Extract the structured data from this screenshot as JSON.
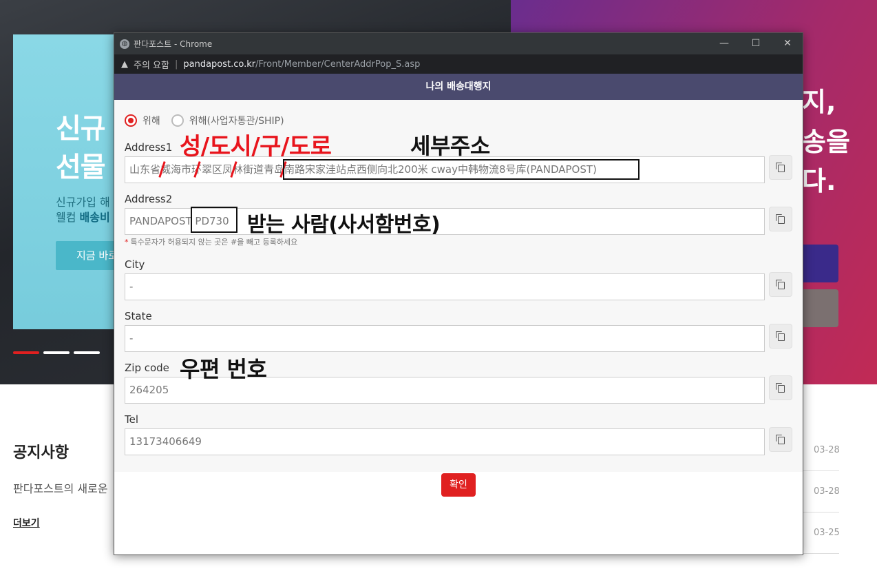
{
  "background": {
    "banner": {
      "title_line1": "신규",
      "title_line2": "선물",
      "sub_line1": "신규가입 해",
      "sub_line2_prefix": "웰컴",
      "sub_line2_bold": "배송비",
      "button": "지금 바로"
    },
    "hero_right_lines": [
      "지,",
      "송을",
      "다."
    ],
    "notice": {
      "title": "공지사항",
      "description": "판다포스트의 새로운",
      "more": "더보기",
      "dates": [
        "03-28",
        "03-28",
        "03-25"
      ]
    }
  },
  "window": {
    "title": "판다포스트 - Chrome",
    "controls": {
      "minimize": "—",
      "maximize": "☐",
      "close": "✕"
    },
    "url_warning": "주의 요함",
    "url_host": "pandapost.co.kr",
    "url_path": "/Front/Member/CenterAddrPop_S.asp"
  },
  "popup": {
    "header": "나의 배송대행지",
    "radios": [
      {
        "label": "위해",
        "checked": true
      },
      {
        "label": "위해(사업자통관/SHIP)",
        "checked": false
      }
    ],
    "fields": [
      {
        "label": "Address1",
        "value": "山东省威海市环翠区凤林街道青岛南路宋家洼站点西侧向北200米 cway中韩物流8号库(PANDAPOST)"
      },
      {
        "label": "Address2",
        "value": "PANDAPOST PD730"
      },
      {
        "label": "City",
        "value": "-"
      },
      {
        "label": "State",
        "value": "-"
      },
      {
        "label": "Zip code",
        "value": "264205"
      },
      {
        "label": "Tel",
        "value": "13173406649"
      }
    ],
    "note": "특수문자가 허용되지 않는 곳은 #을 빼고 등록하세요",
    "note_star": "*",
    "confirm": "확인"
  },
  "annotations": {
    "address1_red": "성/도시/구/도로",
    "address1_black": "세부주소",
    "address2": "받는 사람(사서함번호)",
    "zip": "우편 번호",
    "colors": {
      "red": "#e8141c",
      "black": "#111111"
    }
  },
  "colors": {
    "header_bg": "#4a4a6e",
    "accent_red": "#e02020",
    "titlebar": "#323639"
  }
}
